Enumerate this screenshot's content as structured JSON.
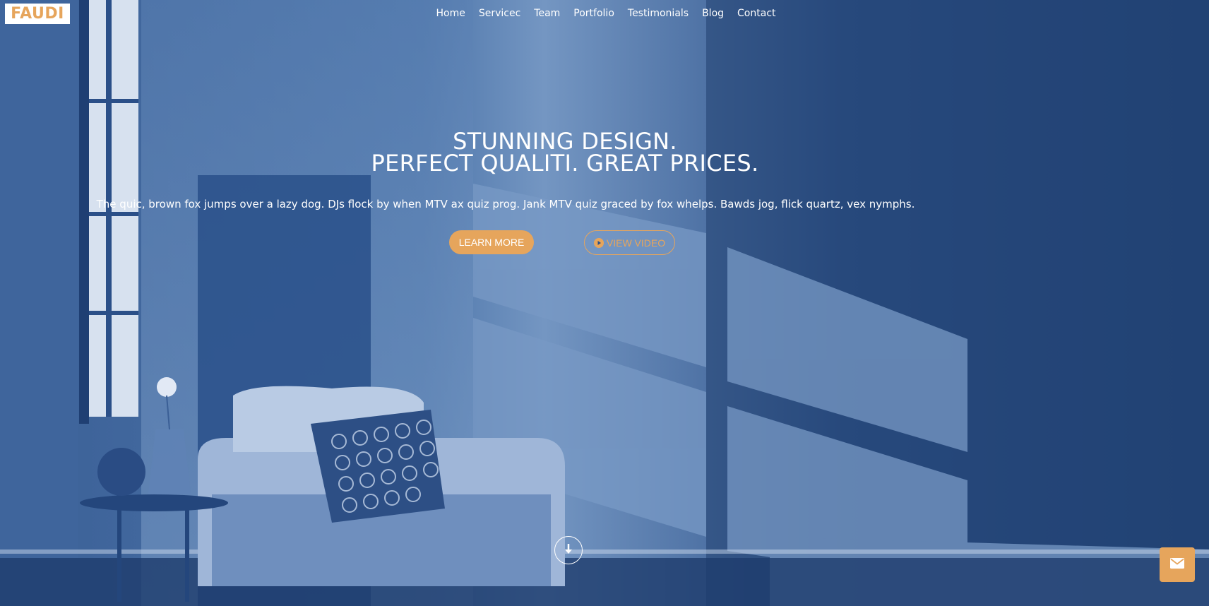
{
  "brand": {
    "logo_text": "FAUDI",
    "accent_color": "#e6a55c",
    "overlay_color": "#264a80"
  },
  "nav": {
    "items": [
      {
        "label": "Home"
      },
      {
        "label": "Servicec"
      },
      {
        "label": "Team"
      },
      {
        "label": "Portfolio"
      },
      {
        "label": "Testimonials"
      },
      {
        "label": "Blog"
      },
      {
        "label": "Contact"
      }
    ]
  },
  "hero": {
    "headline_line1": "STUNNING DESIGN.",
    "headline_line2": "PERFECT QUALITI. GREAT PRICES.",
    "subtext": "The quic, brown fox jumps over a lazy dog. DJs flock by when MTV ax quiz prog. Jank MTV quiz graced by fox whelps. Bawds jog, flick quartz, vex nymphs.",
    "learn_more_label": "LEARN MORE",
    "view_video_label": "VIEW VIDEO",
    "play_icon": "play-circle-icon",
    "scroll_icon": "arrow-down-icon"
  },
  "floating": {
    "mail_icon": "envelope-icon"
  }
}
